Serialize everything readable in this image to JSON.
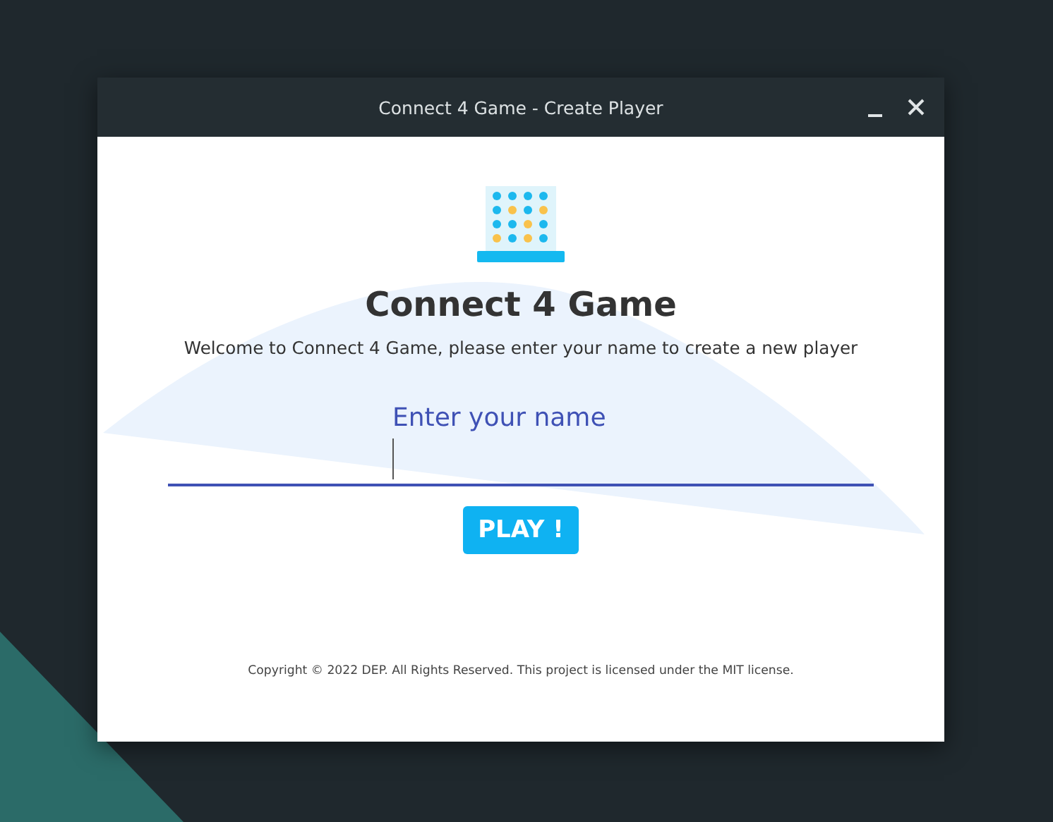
{
  "window": {
    "title": "Connect 4 Game - Create Player",
    "buttons": [
      {
        "kind": "minimize"
      },
      {
        "kind": "close"
      }
    ]
  },
  "heading": "Connect 4 Game",
  "welcome": "Welcome to Connect 4 Game, please enter your name to create a new player",
  "name_field": {
    "label": "Enter your name",
    "focused": true
  },
  "play_button": "PLAY !",
  "footer": "Copyright © 2022 DEP. All Rights Reserved. This project is licensed under the MIT license."
}
